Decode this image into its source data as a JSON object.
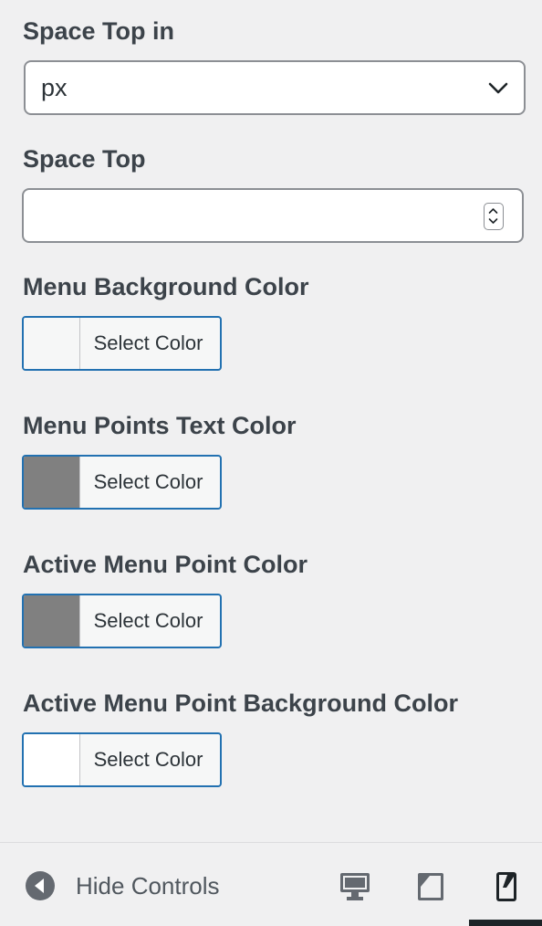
{
  "fields": {
    "space_top_unit": {
      "label": "Space Top in",
      "value": "px"
    },
    "space_top": {
      "label": "Space Top",
      "value": ""
    },
    "menu_background_color": {
      "label": "Menu Background Color",
      "button_label": "Select Color",
      "swatch_color": "#f6f7f7"
    },
    "menu_points_text_color": {
      "label": "Menu Points Text Color",
      "button_label": "Select Color",
      "swatch_color": "#808080"
    },
    "active_menu_point_color": {
      "label": "Active Menu Point Color",
      "button_label": "Select Color",
      "swatch_color": "#808080"
    },
    "active_menu_point_background_color": {
      "label": "Active Menu Point Background Color",
      "button_label": "Select Color",
      "swatch_color": "#ffffff"
    }
  },
  "footer": {
    "hide_controls_label": "Hide Controls",
    "devices": [
      "desktop-icon",
      "tablet-icon",
      "mobile-icon"
    ],
    "active_device": "mobile"
  },
  "colors": {
    "accent": "#2271b1",
    "text": "#3c434a",
    "background": "#f0f0f1"
  }
}
